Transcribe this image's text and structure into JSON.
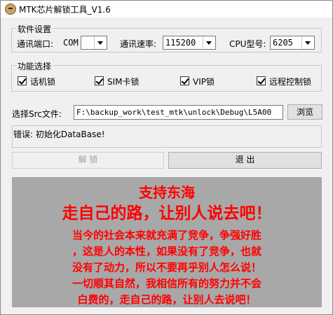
{
  "window": {
    "title": "MTK芯片解锁工具_V1.6"
  },
  "settings": {
    "group_title": "软件设置",
    "port_label": "通讯端口:",
    "port_prefix": "COM",
    "port_value": "",
    "speed_label": "通讯速率:",
    "speed_value": "115200",
    "cpu_label": "CPU型号:",
    "cpu_value": "6205"
  },
  "functions": {
    "group_title": "功能选择",
    "items": [
      {
        "label": "话机锁",
        "checked": true
      },
      {
        "label": "SIM卡锁",
        "checked": true
      },
      {
        "label": "VIP锁",
        "checked": true
      },
      {
        "label": "远程控制锁",
        "checked": true
      }
    ]
  },
  "src": {
    "label": "选择Src文件:",
    "value": "F:\\backup_work\\test_mtk\\unlock\\Debug\\L5A00",
    "browse_label": "浏览"
  },
  "status": {
    "text": "错误: 初始化DataBase!"
  },
  "actions": {
    "unlock_label": "解    锁",
    "exit_label": "退    出"
  },
  "banner": {
    "line1": "支持东海",
    "line2": "走自己的路，让别人说去吧！",
    "paragraph": [
      "当今的社会本来就充满了竞争，争强好胜",
      "，这是人的本性，如果没有了竞争，也就",
      "没有了动力，所以不要再乎别人怎么说！",
      "一切顺其自然，我相信所有的努力并不会",
      "白费的，走自己的路，让别人去说吧！"
    ],
    "text_color": "#ff0000",
    "background_color": "#a8a8a8"
  }
}
